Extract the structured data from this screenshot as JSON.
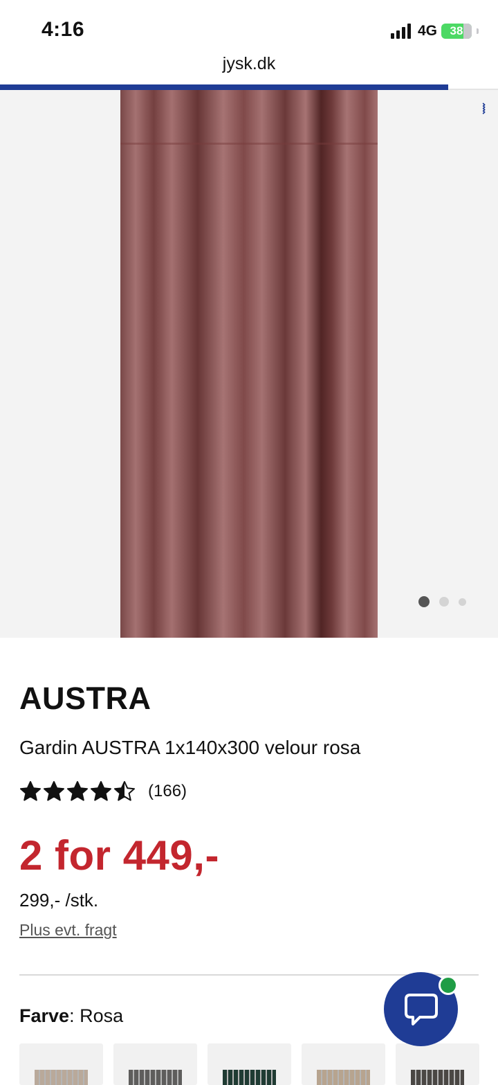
{
  "status_bar": {
    "time": "4:16",
    "network": "4G",
    "battery": "38"
  },
  "browser": {
    "url": "jysk.dk",
    "load_progress": 0.9
  },
  "gallery": {
    "image_count": 3,
    "active_index": 0
  },
  "product": {
    "brand": "AUSTRA",
    "name": "Gardin AUSTRA 1x140x300 velour rosa",
    "rating_stars": 4.5,
    "rating_count": "(166)",
    "offer_price": "2 for 449,-",
    "unit_price": "299,- /stk.",
    "shipping_note": "Plus evt. fragt",
    "color_label": "Farve",
    "color_value": ": Rosa"
  },
  "color_swatches": [
    {
      "name": "beige",
      "color": "#b9a99a"
    },
    {
      "name": "grey",
      "color": "#5e5d5c"
    },
    {
      "name": "green",
      "color": "#1f3b33"
    },
    {
      "name": "sand",
      "color": "#b7a48f"
    },
    {
      "name": "dark-grey",
      "color": "#4a4744"
    }
  ],
  "colors": {
    "accent": "#1f3c95",
    "price_red": "#c3262e",
    "chat_online": "#1f9d45"
  }
}
